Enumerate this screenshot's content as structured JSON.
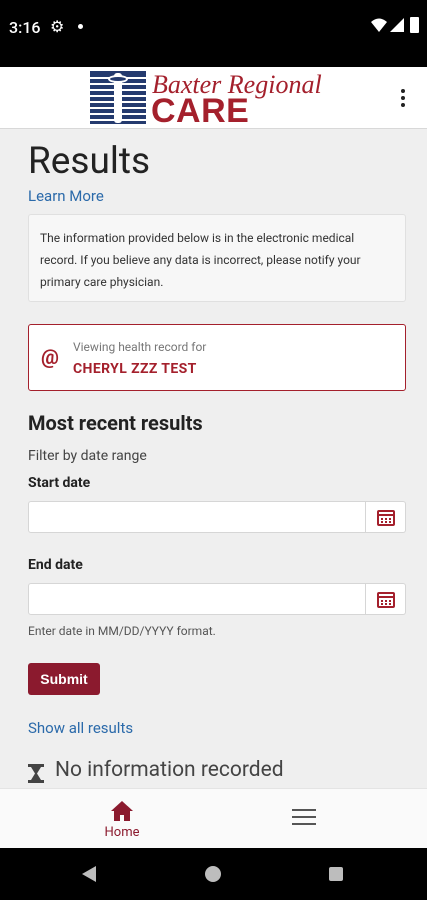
{
  "status_bar": {
    "time": "3:16"
  },
  "header": {
    "logo_line1": "Baxter Regional",
    "logo_line2": "CARE"
  },
  "page": {
    "title": "Results",
    "learn_more": "Learn More",
    "info_text": "The information provided below is in the electronic medical record. If you believe any data is incorrect, please notify your primary care physician."
  },
  "record": {
    "caption": "Viewing health record for",
    "name": "CHERYL ZZZ TEST",
    "icon": "@"
  },
  "results": {
    "section_title": "Most recent results",
    "filter_label": "Filter by date range",
    "start_label": "Start date",
    "start_value": "",
    "end_label": "End date",
    "end_value": "",
    "hint": "Enter date in MM/DD/YYYY format.",
    "submit_label": "Submit",
    "show_all": "Show all results",
    "no_info": "No information recorded"
  },
  "bottom_nav": {
    "home_label": "Home"
  },
  "colors": {
    "brand": "#a4202c",
    "button": "#8b1a2e",
    "link": "#2b6aaa"
  }
}
